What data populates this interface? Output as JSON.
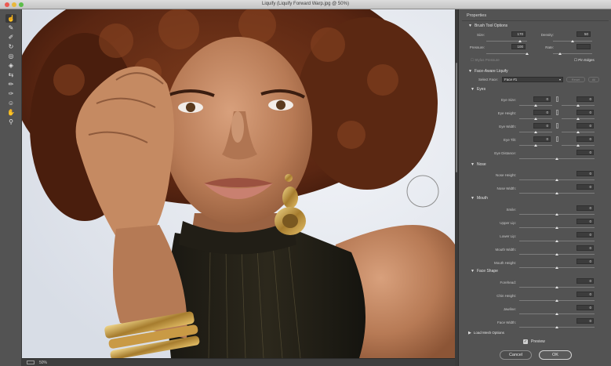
{
  "window": {
    "title": "Liquify (Liquify Forward Warp.jpg @ 50%)"
  },
  "tools": [
    {
      "icon": "forward-warp-tool-icon",
      "glyph": "☝"
    },
    {
      "icon": "reconstruct-tool-icon",
      "glyph": "✎"
    },
    {
      "icon": "smooth-tool-icon",
      "glyph": "✐"
    },
    {
      "icon": "twirl-tool-icon",
      "glyph": "↻"
    },
    {
      "icon": "pucker-tool-icon",
      "glyph": "◎"
    },
    {
      "icon": "bloat-tool-icon",
      "glyph": "◈"
    },
    {
      "icon": "push-left-tool-icon",
      "glyph": "⇆"
    },
    {
      "icon": "freeze-mask-tool-icon",
      "glyph": "✏"
    },
    {
      "icon": "thaw-mask-tool-icon",
      "glyph": "✑"
    },
    {
      "icon": "face-tool-icon",
      "glyph": "☺"
    },
    {
      "icon": "hand-tool-icon",
      "glyph": "✋"
    },
    {
      "icon": "zoom-tool-icon",
      "glyph": "⚲"
    }
  ],
  "status": {
    "zoom": "50%"
  },
  "panel": {
    "title": "Properties",
    "brush_tool_options": {
      "heading": "Brush Tool Options",
      "size_label": "Size:",
      "size_value": "170",
      "density_label": "Density:",
      "density_value": "50",
      "pressure_label": "Pressure:",
      "pressure_value": "100",
      "rate_label": "Rate:",
      "rate_value": "",
      "stylus_pressure_label": "Stylus Pressure",
      "pin_edges_label": "Pin Edges"
    },
    "face_aware": {
      "heading": "Face-Aware Liquify",
      "select_face_label": "Select Face:",
      "select_face_value": "Face #1",
      "reset_label": "Reset",
      "all_label": "All"
    },
    "eyes": {
      "heading": "Eyes",
      "rows": [
        {
          "label": "Eye Size:",
          "left": "0",
          "right": "0",
          "linked": true
        },
        {
          "label": "Eye Height:",
          "left": "0",
          "right": "0",
          "linked": true
        },
        {
          "label": "Eye Width:",
          "left": "0",
          "right": "0",
          "linked": true
        },
        {
          "label": "Eye Tilt:",
          "left": "0",
          "right": "0",
          "linked": true
        },
        {
          "label": "Eye Distance:",
          "single": "0"
        }
      ]
    },
    "nose": {
      "heading": "Nose",
      "rows": [
        {
          "label": "Nose Height:",
          "value": "0"
        },
        {
          "label": "Nose Width:",
          "value": "0"
        }
      ]
    },
    "mouth": {
      "heading": "Mouth",
      "rows": [
        {
          "label": "Smile:",
          "value": "0"
        },
        {
          "label": "Upper Lip:",
          "value": "0"
        },
        {
          "label": "Lower Lip:",
          "value": "0"
        },
        {
          "label": "Mouth Width:",
          "value": "0"
        },
        {
          "label": "Mouth Height:",
          "value": "0"
        }
      ]
    },
    "face_shape": {
      "heading": "Face Shape",
      "rows": [
        {
          "label": "Forehead:",
          "value": "0"
        },
        {
          "label": "Chin Height:",
          "value": "0"
        },
        {
          "label": "Jawline:",
          "value": "0"
        },
        {
          "label": "Face Width:",
          "value": "0"
        }
      ]
    },
    "load_mesh_heading": "Load Mesh Options",
    "preview_label": "Preview",
    "preview_checked": true,
    "cancel_label": "Cancel",
    "ok_label": "OK"
  }
}
